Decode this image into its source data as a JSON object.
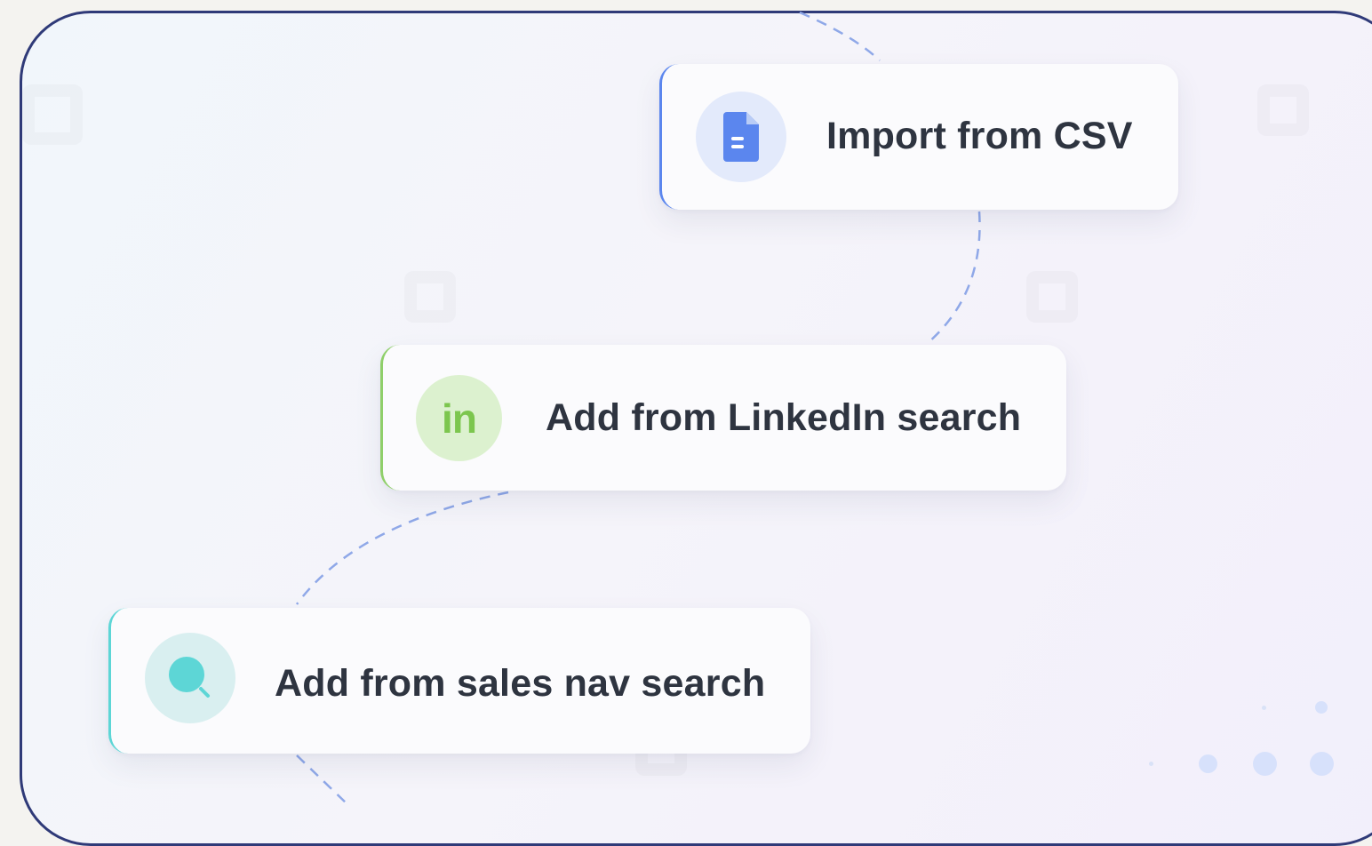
{
  "colors": {
    "frame_border": "#2f3a78",
    "csv_accent": "#5b86ee",
    "linkedin_accent": "#8fcf6a",
    "salesnav_accent": "#5dd6d6",
    "connector": "#8fa8e8"
  },
  "cards": [
    {
      "id": "csv",
      "label": "Import from CSV",
      "icon": "document-icon"
    },
    {
      "id": "linkedin",
      "label": "Add from LinkedIn search",
      "icon": "linkedin-icon",
      "icon_text": "in"
    },
    {
      "id": "salesnav",
      "label": "Add from sales nav search",
      "icon": "search-icon"
    }
  ]
}
